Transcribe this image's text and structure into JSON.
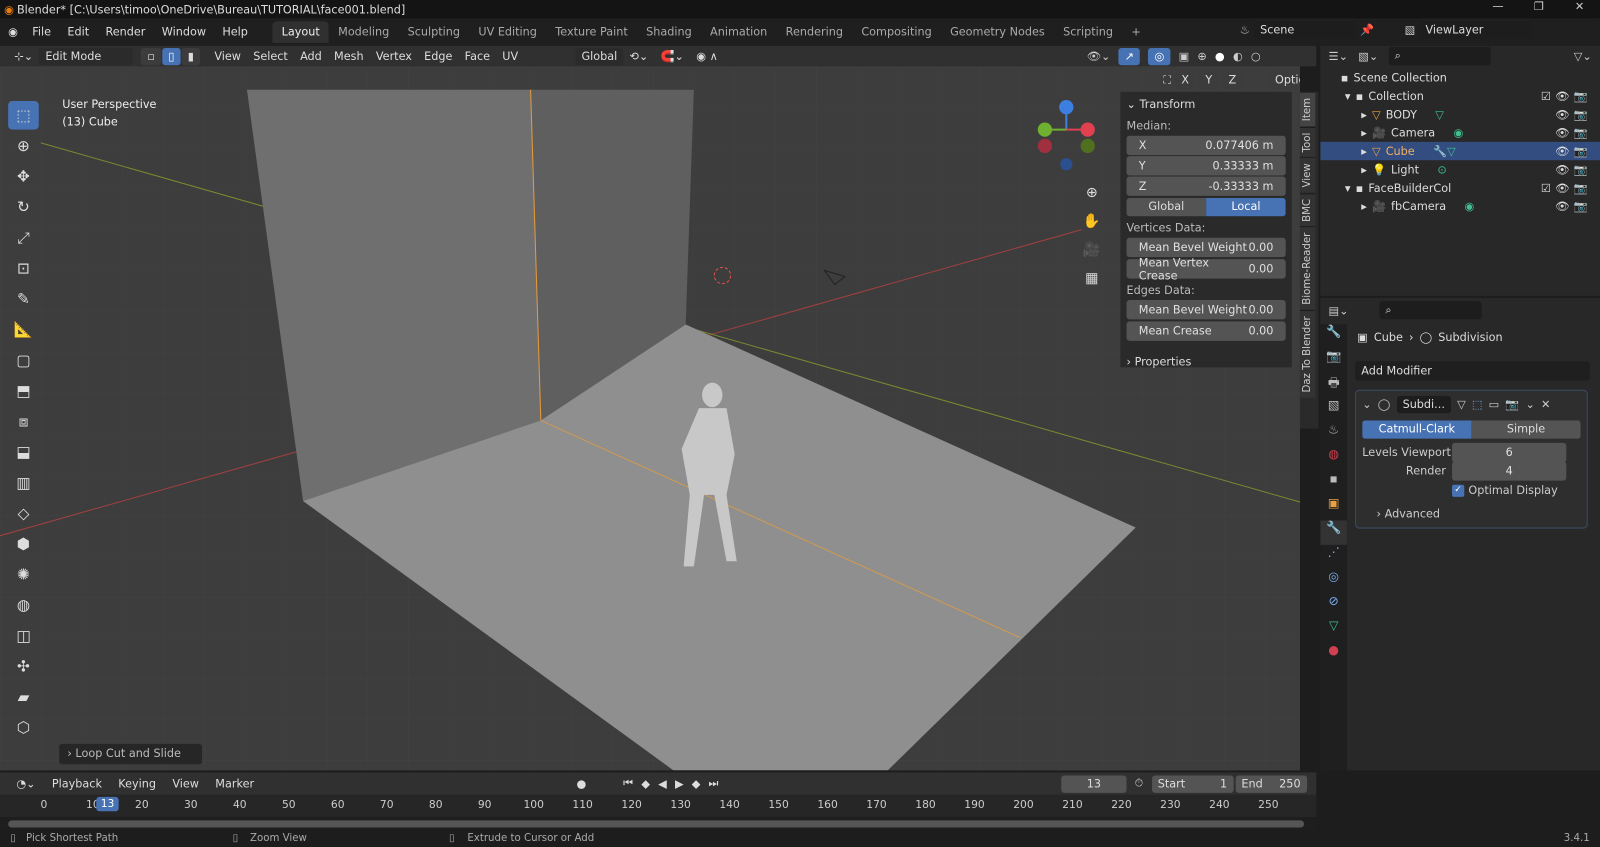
{
  "window": {
    "title": "Blender* [C:\\Users\\timoo\\OneDrive\\Bureau\\TUTORIAL\\face001.blend]"
  },
  "menu": [
    "File",
    "Edit",
    "Render",
    "Window",
    "Help"
  ],
  "workspaces": [
    "Layout",
    "Modeling",
    "Sculpting",
    "UV Editing",
    "Texture Paint",
    "Shading",
    "Animation",
    "Rendering",
    "Compositing",
    "Geometry Nodes",
    "Scripting",
    "+"
  ],
  "scene": {
    "scene_name": "Scene",
    "view_layer": "ViewLayer"
  },
  "header": {
    "mode": "Edit Mode",
    "menus": [
      "View",
      "Select",
      "Add",
      "Mesh",
      "Vertex",
      "Edge",
      "Face",
      "UV"
    ],
    "orientation": "Global",
    "options": "Options",
    "axes": [
      "X",
      "Y",
      "Z"
    ]
  },
  "viewport": {
    "view_name": "User Perspective",
    "object_info": "(13) Cube",
    "last_op": "Loop Cut and Slide"
  },
  "npanel": {
    "title": "Transform",
    "median_label": "Median:",
    "x_label": "X",
    "x": "0.077406 m",
    "y_label": "Y",
    "y": "0.33333 m",
    "z_label": "Z",
    "z": "-0.33333 m",
    "global": "Global",
    "local": "Local",
    "vertices_label": "Vertices Data:",
    "v_bevel_label": "Mean Bevel Weight",
    "v_bevel": "0.00",
    "v_crease_label": "Mean Vertex Crease",
    "v_crease": "0.00",
    "edges_label": "Edges Data:",
    "e_bevel_label": "Mean Bevel Weight",
    "e_bevel": "0.00",
    "e_crease_label": "Mean Crease",
    "e_crease": "0.00",
    "properties": "Properties"
  },
  "side_tabs": [
    "Item",
    "Tool",
    "View",
    "BMC",
    "Biome-Reader",
    "Daz To Blender"
  ],
  "outliner": {
    "root": "Scene Collection",
    "items": [
      {
        "name": "Collection"
      },
      {
        "name": "BODY"
      },
      {
        "name": "Camera"
      },
      {
        "name": "Cube"
      },
      {
        "name": "Light"
      },
      {
        "name": "FaceBuilderCol"
      },
      {
        "name": "fbCamera"
      }
    ]
  },
  "properties": {
    "object": "Cube",
    "modifier": "Subdivision",
    "add_modifier": "Add Modifier",
    "mod_name": "Subdi...",
    "catmull": "Catmull-Clark",
    "simple": "Simple",
    "levels_label": "Levels Viewport",
    "levels": "6",
    "render_label": "Render",
    "render": "4",
    "optimal": "Optimal Display",
    "advanced": "Advanced"
  },
  "timeline": {
    "menus": [
      "Playback",
      "Keying",
      "View",
      "Marker"
    ],
    "current": "13",
    "start_label": "Start",
    "start": "1",
    "end_label": "End",
    "end": "250",
    "ticks": [
      "0",
      "10",
      "20",
      "30",
      "40",
      "50",
      "60",
      "70",
      "80",
      "90",
      "100",
      "110",
      "120",
      "130",
      "140",
      "150",
      "160",
      "170",
      "180",
      "190",
      "200",
      "210",
      "220",
      "230",
      "240",
      "250"
    ]
  },
  "status": {
    "left": "Pick Shortest Path",
    "mid": "Zoom View",
    "right": "Extrude to Cursor or Add",
    "version": "3.4.1"
  }
}
